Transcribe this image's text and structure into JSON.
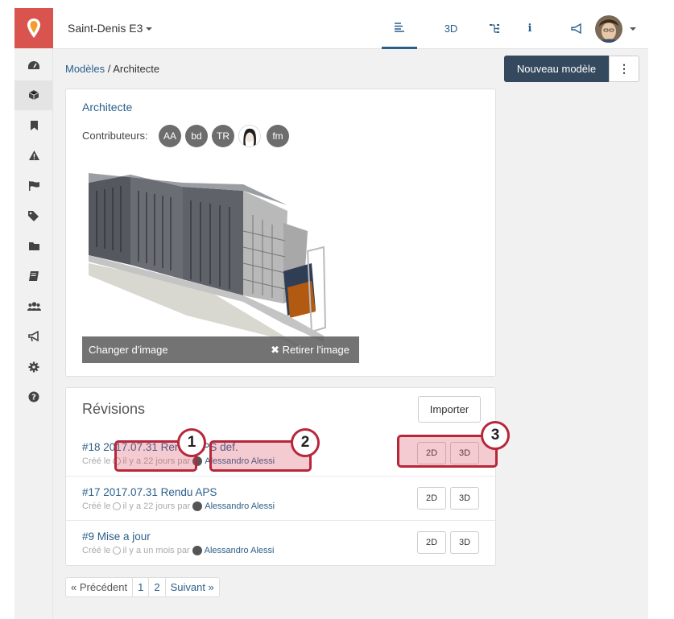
{
  "topbar": {
    "project": "Saint-Denis E3",
    "nav": [
      {
        "name": "list-view-icon",
        "label": ""
      },
      {
        "name": "3d-tab",
        "label": "3D"
      },
      {
        "name": "tree-icon",
        "label": ""
      },
      {
        "name": "info-icon",
        "label": "i"
      },
      {
        "name": "megaphone-icon",
        "label": ""
      }
    ]
  },
  "sidebar": {
    "icons": [
      "dashboard-icon",
      "cube-icon",
      "bookmark-icon",
      "warning-icon",
      "flag-icon",
      "tags-icon",
      "folder-icon",
      "book-icon",
      "users-icon",
      "megaphone-icon",
      "gear-icon",
      "help-icon"
    ],
    "active": "cube-icon"
  },
  "breadcrumb": {
    "parent": "Modèles",
    "sep": " / ",
    "current": "Architecte"
  },
  "actions": {
    "new_model": "Nouveau modèle",
    "more": "⋮"
  },
  "model": {
    "title": "Architecte",
    "contributors_label": "Contributeurs:",
    "contributors": [
      "AA",
      "bd",
      "TR",
      "",
      "fm"
    ],
    "change_image": "Changer d'image",
    "remove_image": "✖ Retirer l'image"
  },
  "revisions": {
    "title": "Révisions",
    "import": "Importer",
    "items": [
      {
        "title": "#18 2017.07.31 Rendu APS def.",
        "created": "Créé le",
        "time": "il y a 22 jours par",
        "author": "Alessandro Alessi",
        "b2d": "2D",
        "b3d": "3D"
      },
      {
        "title": "#17 2017.07.31 Rendu APS",
        "created": "Créé le",
        "time": "il y a 22 jours par",
        "author": "Alessandro Alessi",
        "b2d": "2D",
        "b3d": "3D"
      },
      {
        "title": "#9 Mise a jour",
        "created": "Créé le",
        "time": "il y a un mois par",
        "author": "Alessandro Alessi",
        "b2d": "2D",
        "b3d": "3D"
      }
    ]
  },
  "annotations": [
    "1",
    "2",
    "3"
  ],
  "pager": {
    "prev": "« Précédent",
    "p1": "1",
    "p2": "2",
    "next": "Suivant »"
  },
  "colors": {
    "brand": "#d9534f",
    "primary": "#34495e",
    "link": "#2a5f8a",
    "highlight": "#b8263a"
  }
}
